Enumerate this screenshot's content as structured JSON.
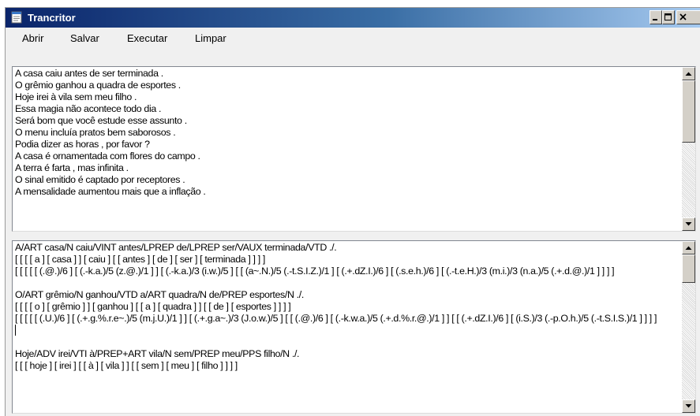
{
  "window": {
    "title": "Trancritor",
    "icon": "notepad-app-icon",
    "controls": [
      "minimize-icon",
      "maximize-icon",
      "close-icon"
    ]
  },
  "menu": {
    "items": [
      "Abrir",
      "Salvar",
      "Executar",
      "Limpar"
    ]
  },
  "input_pane": {
    "lines": [
      "A casa caiu antes de ser terminada .",
      "O grêmio ganhou a quadra de esportes .",
      "Hoje irei à vila sem meu filho .",
      "Essa magia não acontece todo dia .",
      "Será bom que você estude esse assunto .",
      "O menu incluía pratos bem saborosos .",
      "Podia dizer as horas , por favor ?",
      "A casa é ornamentada com flores do campo .",
      "A terra é farta , mas infinita .",
      "O sinal emitido é captado por receptores .",
      "A mensalidade aumentou mais que a inflação ."
    ]
  },
  "output_pane": {
    "blocks": [
      {
        "tagged": "A/ART casa/N caiu/VINT antes/LPREP de/LPREP ser/VAUX terminada/VTD ./.",
        "words": "[ [ [ [ a ] [ casa ] ] [ caiu ] [ [ antes ] [ de ] [ ser ] [ terminada ] ] ] ]",
        "phonetic": "[ [ [ [ [ (.@.)/6 ] [ (.-k.a.)/5 (z.@.)/1 ] ] [ (.-k.a.)/3 (i.w.)/5 ] [ [ (a~.N.)/5 (.-t.S.I.Z.)/1 ] [ (.+.dZ.I.)/6 ] [ (.s.e.h.)/6 ] [ (.-t.e.H.)/3 (m.i.)/3 (n.a.)/5 (.+.d.@.)/1 ] ] ] ]"
      },
      {
        "tagged": "O/ART grêmio/N ganhou/VTD a/ART quadra/N de/PREP esportes/N ./.",
        "words": "[ [ [ [ o ] [ grêmio ] ] [ ganhou ] [ [ a ] [ quadra ] ] [ [ de ] [ esportes ] ] ] ]",
        "phonetic": "[ [ [ [ [ (.U.)/6 ] [ (.+.g.%.r.e~.)/5 (m.j.U.)/1 ] ] [ (.+.g.a~.)/3 (J.o.w.)/5 ] [ [ (.@.)/6 ] [ (.-k.w.a.)/5 (.+.d.%.r.@.)/1 ] ] [ [ (.+.dZ.I.)/6 ] [ (i.S.)/3 (.-p.O.h.)/5 (.-t.S.I.S.)/1 ] ] ] ]"
      },
      {
        "tagged": "Hoje/ADV irei/VTI à/PREP+ART vila/N sem/PREP meu/PPS filho/N ./.",
        "words": "[ [ [ hoje ] [ irei ] [ [ à ] [ vila ] ] [ [ sem ] [ meu ] [ filho ] ] ] ]"
      }
    ]
  },
  "scrollbars": {
    "up_arrow": "arrow-up-icon",
    "down_arrow": "arrow-down-icon"
  }
}
